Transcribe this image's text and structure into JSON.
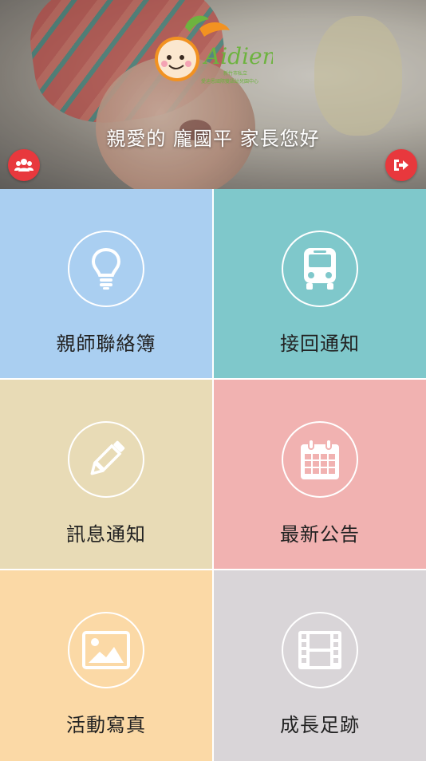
{
  "header": {
    "greeting": "親愛的 龐國平 家長您好",
    "logo": {
      "brand": "Aidien",
      "line1": "新竹市私立",
      "line2": "愛迪恩國際雙語幼兒園中心"
    },
    "left_button_icon": "users-icon",
    "right_button_icon": "logout-icon"
  },
  "tiles": [
    {
      "label": "親師聯絡簿",
      "icon": "lightbulb-icon",
      "color": "#aacff1"
    },
    {
      "label": "接回通知",
      "icon": "bus-icon",
      "color": "#7fc8cb"
    },
    {
      "label": "訊息通知",
      "icon": "pencil-icon",
      "color": "#e8dbb6"
    },
    {
      "label": "最新公告",
      "icon": "calendar-icon",
      "color": "#f1b2b1"
    },
    {
      "label": "活動寫真",
      "icon": "image-icon",
      "color": "#fbd9a6"
    },
    {
      "label": "成長足跡",
      "icon": "film-icon",
      "color": "#d9d5d8"
    }
  ],
  "colors": {
    "accent_red": "#e8383d"
  }
}
